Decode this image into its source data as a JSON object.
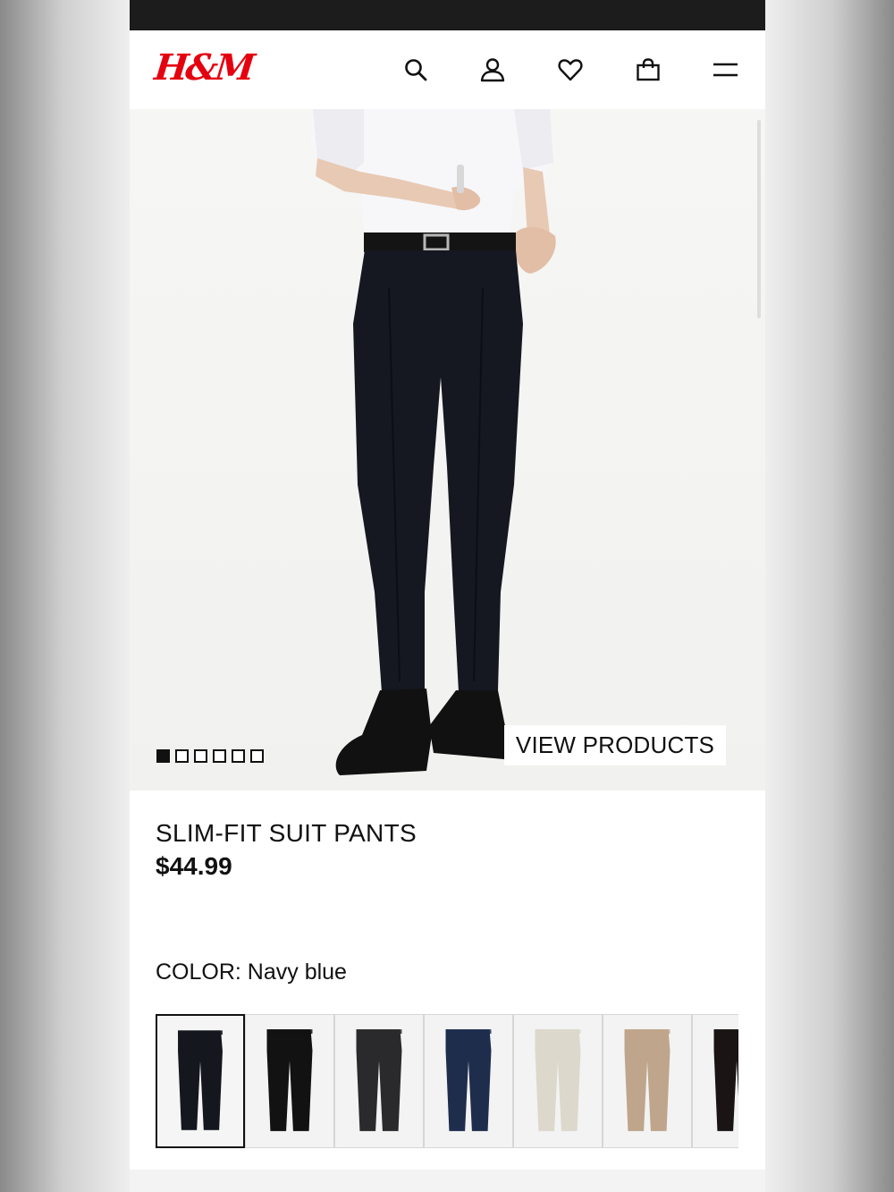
{
  "header": {
    "logo": "H&M",
    "icons": [
      "search-icon",
      "account-icon",
      "heart-icon",
      "bag-icon",
      "menu-icon"
    ]
  },
  "hero": {
    "gallery_count": 6,
    "gallery_active": 1,
    "view_products_label": "VIEW PRODUCTS"
  },
  "product": {
    "name": "SLIM-FIT SUIT PANTS",
    "price": "$44.99",
    "color_label": "COLOR: Navy blue",
    "swatches": [
      {
        "color": "#15171f",
        "selected": true
      },
      {
        "color": "#121212",
        "selected": false
      },
      {
        "color": "#2a2a2c",
        "selected": false
      },
      {
        "color": "#1f2d4d",
        "selected": false
      },
      {
        "color": "#dcd8cb",
        "selected": false
      },
      {
        "color": "#bfa58b",
        "selected": false
      },
      {
        "color": "#1a1514",
        "selected": false
      }
    ]
  },
  "colors": {
    "brand": "#e50010",
    "text": "#111111",
    "status_bar": "#1c1c1c"
  }
}
